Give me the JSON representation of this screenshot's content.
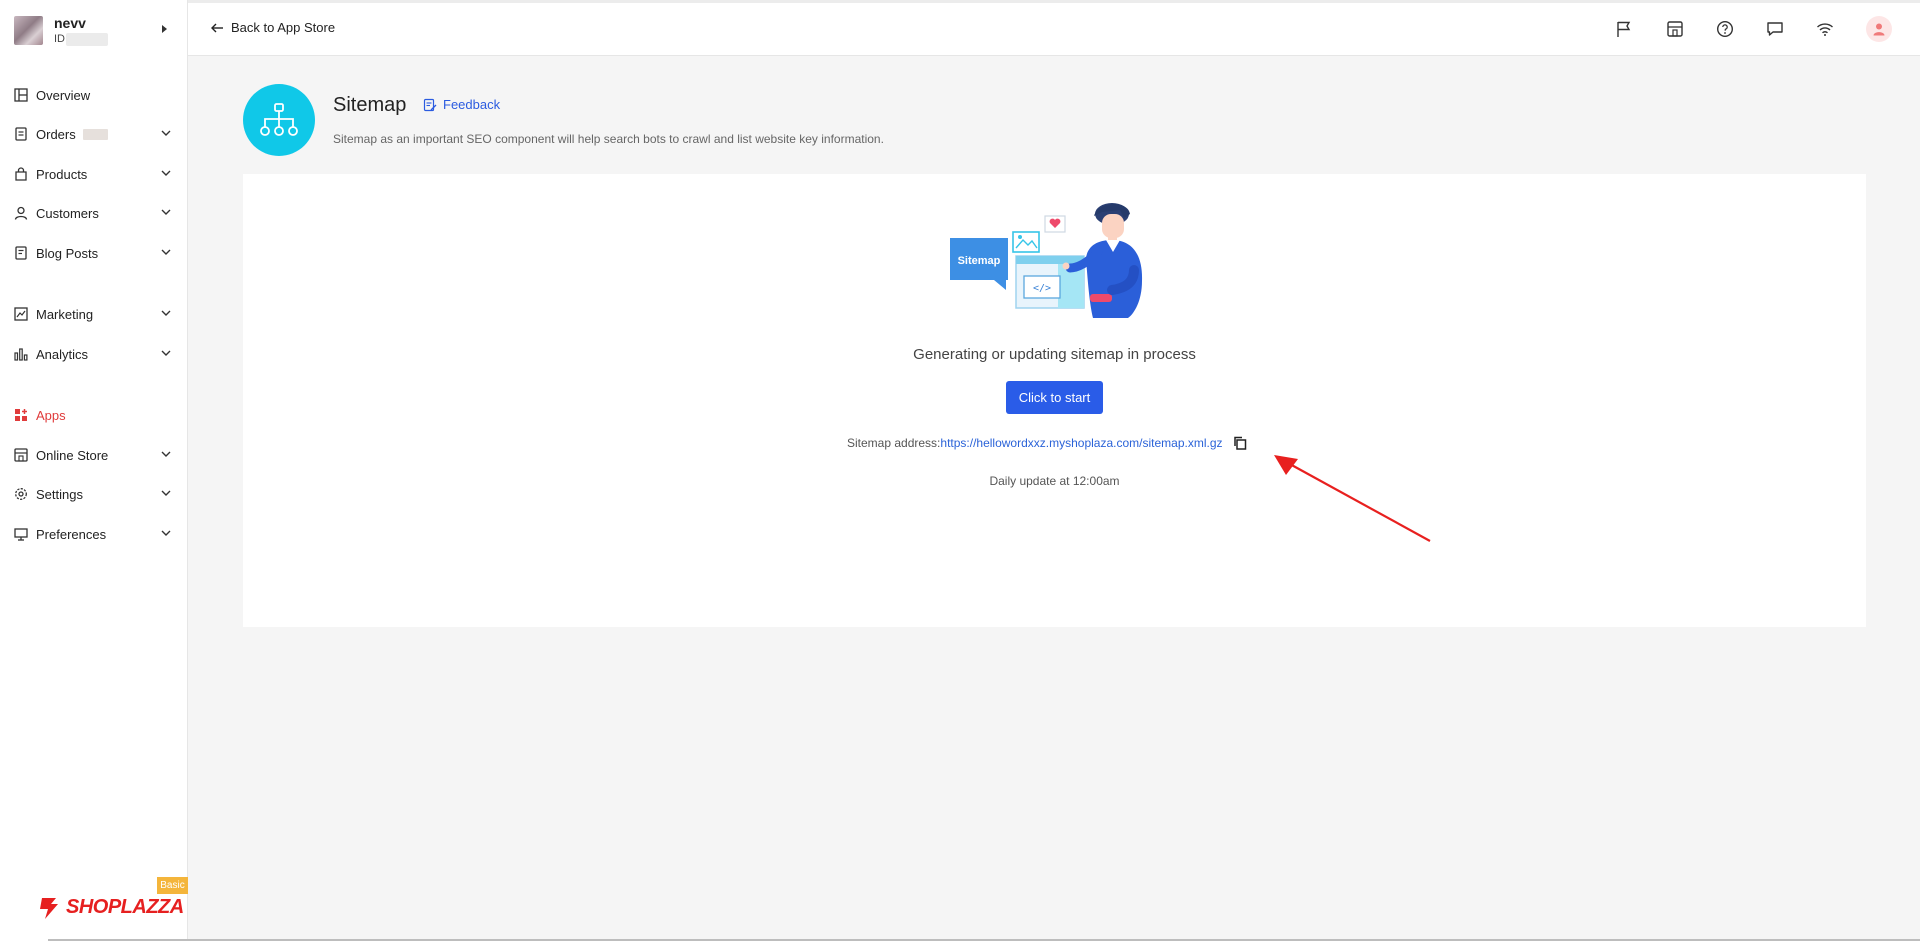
{
  "store": {
    "name": "nevv",
    "id_prefix": "ID"
  },
  "sidebar": {
    "items": [
      {
        "label": "Overview",
        "icon": "overview-icon"
      },
      {
        "label": "Orders",
        "icon": "orders-icon"
      },
      {
        "label": "Products",
        "icon": "products-icon"
      },
      {
        "label": "Customers",
        "icon": "customers-icon"
      },
      {
        "label": "Blog Posts",
        "icon": "blog-posts-icon"
      },
      {
        "label": "Marketing",
        "icon": "marketing-icon"
      },
      {
        "label": "Analytics",
        "icon": "analytics-icon"
      },
      {
        "label": "Apps",
        "icon": "apps-icon"
      },
      {
        "label": "Online Store",
        "icon": "online-store-icon"
      },
      {
        "label": "Settings",
        "icon": "settings-icon"
      },
      {
        "label": "Preferences",
        "icon": "preferences-icon"
      }
    ],
    "badge": "Basic",
    "logo_text": "SHOPLAZZA"
  },
  "topbar": {
    "back_label": "Back to App Store",
    "icons": [
      "flag-icon",
      "store-icon",
      "help-icon",
      "message-icon",
      "wifi-icon",
      "user-icon"
    ]
  },
  "app": {
    "title": "Sitemap",
    "feedback_label": "Feedback",
    "description": "Sitemap as an important SEO component will help search bots to crawl and list website key information."
  },
  "card": {
    "illustration_label": "Sitemap",
    "status": "Generating or updating sitemap in process",
    "button_label": "Click to start",
    "address_label": "Sitemap address:",
    "address_url": "https://hellowordxxz.myshoplaza.com/sitemap.xml.gz",
    "daily_update": "Daily update at 12:00am"
  },
  "colors": {
    "primary": "#2a5ce8",
    "link": "#2b63d8",
    "active_nav": "#e03b3b",
    "app_logo": "#10c8e8",
    "annotation_arrow": "#e8201f",
    "brand": "#e62020"
  }
}
